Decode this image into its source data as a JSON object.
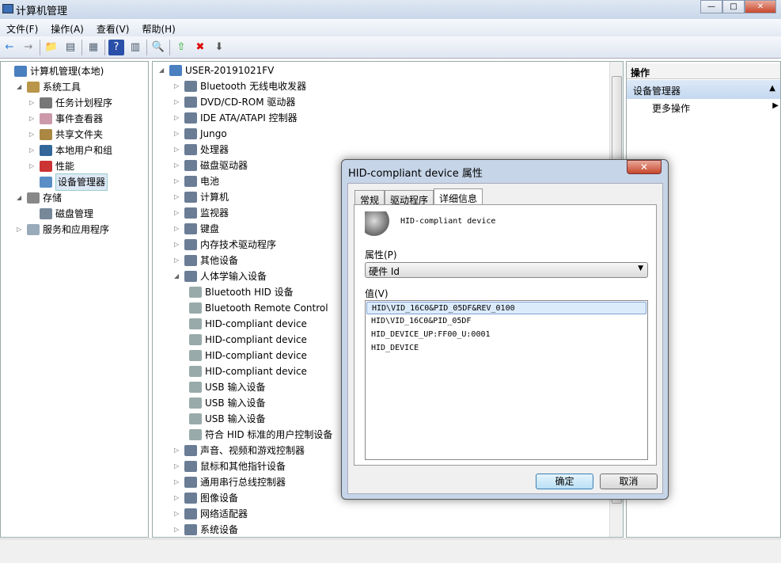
{
  "window": {
    "title": "计算机管理",
    "min": "—",
    "max": "□",
    "close": "✕"
  },
  "menu": [
    "文件(F)",
    "操作(A)",
    "查看(V)",
    "帮助(H)"
  ],
  "toolbar": [
    "back-icon",
    "forward-icon",
    "up-icon",
    "show-hide-tree-icon",
    "properties-icon",
    "help-icon",
    "show-action-pane-icon",
    "scan-hardware-icon",
    "update-driver-icon",
    "uninstall-icon",
    "disable-icon"
  ],
  "left_tree": [
    {
      "label": "计算机管理(本地)",
      "level": 0,
      "arrow": ""
    },
    {
      "label": "系统工具",
      "level": 1,
      "arrow": "◢"
    },
    {
      "label": "任务计划程序",
      "level": 2,
      "arrow": "▷"
    },
    {
      "label": "事件查看器",
      "level": 2,
      "arrow": "▷"
    },
    {
      "label": "共享文件夹",
      "level": 2,
      "arrow": "▷"
    },
    {
      "label": "本地用户和组",
      "level": 2,
      "arrow": "▷"
    },
    {
      "label": "性能",
      "level": 2,
      "arrow": "▷"
    },
    {
      "label": "设备管理器",
      "level": 2,
      "arrow": "",
      "selected": true
    },
    {
      "label": "存储",
      "level": 1,
      "arrow": "◢"
    },
    {
      "label": "磁盘管理",
      "level": 2,
      "arrow": ""
    },
    {
      "label": "服务和应用程序",
      "level": 1,
      "arrow": "▷"
    }
  ],
  "device_tree": {
    "root": "USER-20191021FV",
    "items": [
      {
        "label": "Bluetooth 无线电收发器",
        "level": 1,
        "arrow": "▷"
      },
      {
        "label": "DVD/CD-ROM 驱动器",
        "level": 1,
        "arrow": "▷"
      },
      {
        "label": "IDE ATA/ATAPI 控制器",
        "level": 1,
        "arrow": "▷"
      },
      {
        "label": "Jungo",
        "level": 1,
        "arrow": "▷"
      },
      {
        "label": "处理器",
        "level": 1,
        "arrow": "▷"
      },
      {
        "label": "磁盘驱动器",
        "level": 1,
        "arrow": "▷"
      },
      {
        "label": "电池",
        "level": 1,
        "arrow": "▷"
      },
      {
        "label": "计算机",
        "level": 1,
        "arrow": "▷"
      },
      {
        "label": "监视器",
        "level": 1,
        "arrow": "▷"
      },
      {
        "label": "键盘",
        "level": 1,
        "arrow": "▷"
      },
      {
        "label": "内存技术驱动程序",
        "level": 1,
        "arrow": "▷"
      },
      {
        "label": "其他设备",
        "level": 1,
        "arrow": "▷"
      },
      {
        "label": "人体学输入设备",
        "level": 1,
        "arrow": "◢"
      },
      {
        "label": "Bluetooth HID 设备",
        "level": 2,
        "arrow": ""
      },
      {
        "label": "Bluetooth Remote Control",
        "level": 2,
        "arrow": ""
      },
      {
        "label": "HID-compliant device",
        "level": 2,
        "arrow": ""
      },
      {
        "label": "HID-compliant device",
        "level": 2,
        "arrow": ""
      },
      {
        "label": "HID-compliant device",
        "level": 2,
        "arrow": ""
      },
      {
        "label": "HID-compliant device",
        "level": 2,
        "arrow": ""
      },
      {
        "label": "USB 输入设备",
        "level": 2,
        "arrow": ""
      },
      {
        "label": "USB 输入设备",
        "level": 2,
        "arrow": ""
      },
      {
        "label": "USB 输入设备",
        "level": 2,
        "arrow": ""
      },
      {
        "label": "符合 HID 标准的用户控制设备",
        "level": 2,
        "arrow": ""
      },
      {
        "label": "声音、视频和游戏控制器",
        "level": 1,
        "arrow": "▷"
      },
      {
        "label": "鼠标和其他指针设备",
        "level": 1,
        "arrow": "▷"
      },
      {
        "label": "通用串行总线控制器",
        "level": 1,
        "arrow": "▷"
      },
      {
        "label": "图像设备",
        "level": 1,
        "arrow": "▷"
      },
      {
        "label": "网络适配器",
        "level": 1,
        "arrow": "▷"
      },
      {
        "label": "系统设备",
        "level": 1,
        "arrow": "▷"
      }
    ]
  },
  "actions": {
    "header": "操作",
    "section": "设备管理器",
    "more": "更多操作"
  },
  "dialog": {
    "title": "HID-compliant device 属性",
    "close": "✕",
    "tabs": [
      "常规",
      "驱动程序",
      "详细信息"
    ],
    "device_name": "HID-compliant device",
    "property_label": "属性(P)",
    "property_value": "硬件 Id",
    "value_label": "值(V)",
    "values": [
      "HID\\VID_16C0&PID_05DF&REV_0100",
      "HID\\VID_16C0&PID_05DF",
      "HID_DEVICE_UP:FF00_U:0001",
      "HID_DEVICE"
    ],
    "ok": "确定",
    "cancel": "取消"
  }
}
